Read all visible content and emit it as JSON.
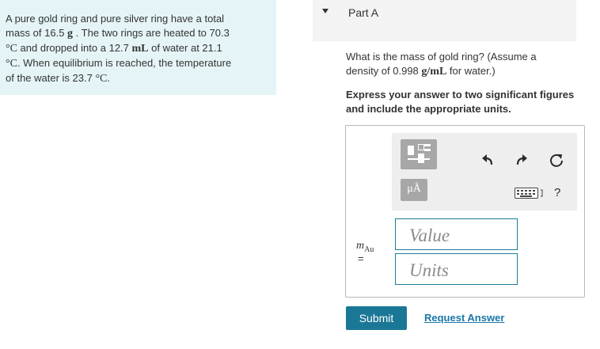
{
  "problem": {
    "line1": "A pure gold ring and pure silver ring have a total",
    "line2a": "mass of 16.5 ",
    "line2m": "g",
    "line2b": " . The two rings are heated to 70.3",
    "line3m": "°C",
    "line3a": " and dropped into a 12.7 ",
    "line3m2": "mL",
    "line3b": " of water at 21.1",
    "line4m": "°C",
    "line4a": ". When equilibrium is reached, the temperature",
    "line5a": "of the water is 23.7 ",
    "line5m": "°C",
    "line5b": "."
  },
  "part": {
    "title": "Part A"
  },
  "question": {
    "text1": "What is the mass of gold ring? (Assume a",
    "text2a": "density of 0.998 ",
    "text2m": "g/mL",
    "text2b": " for water.)"
  },
  "instruction": {
    "text": "Express your answer to two significant figures and include the appropriate units."
  },
  "toolbar": {
    "units_label": "μÅ",
    "help_label": "?",
    "icons": [
      "templates-icon",
      "units-icon",
      "undo-icon",
      "redo-icon",
      "reset-icon",
      "keyboard-icon",
      "help-icon"
    ]
  },
  "answer": {
    "variable": "m",
    "subscript": "Au",
    "equals": "=",
    "value_placeholder": "Value",
    "units_placeholder": "Units"
  },
  "actions": {
    "submit_label": "Submit",
    "request_label": "Request Answer"
  },
  "colors": {
    "problem_bg": "#e5f5f7",
    "accent": "#1b7796",
    "field_border": "#1a7f99",
    "link": "#1a77a7"
  }
}
